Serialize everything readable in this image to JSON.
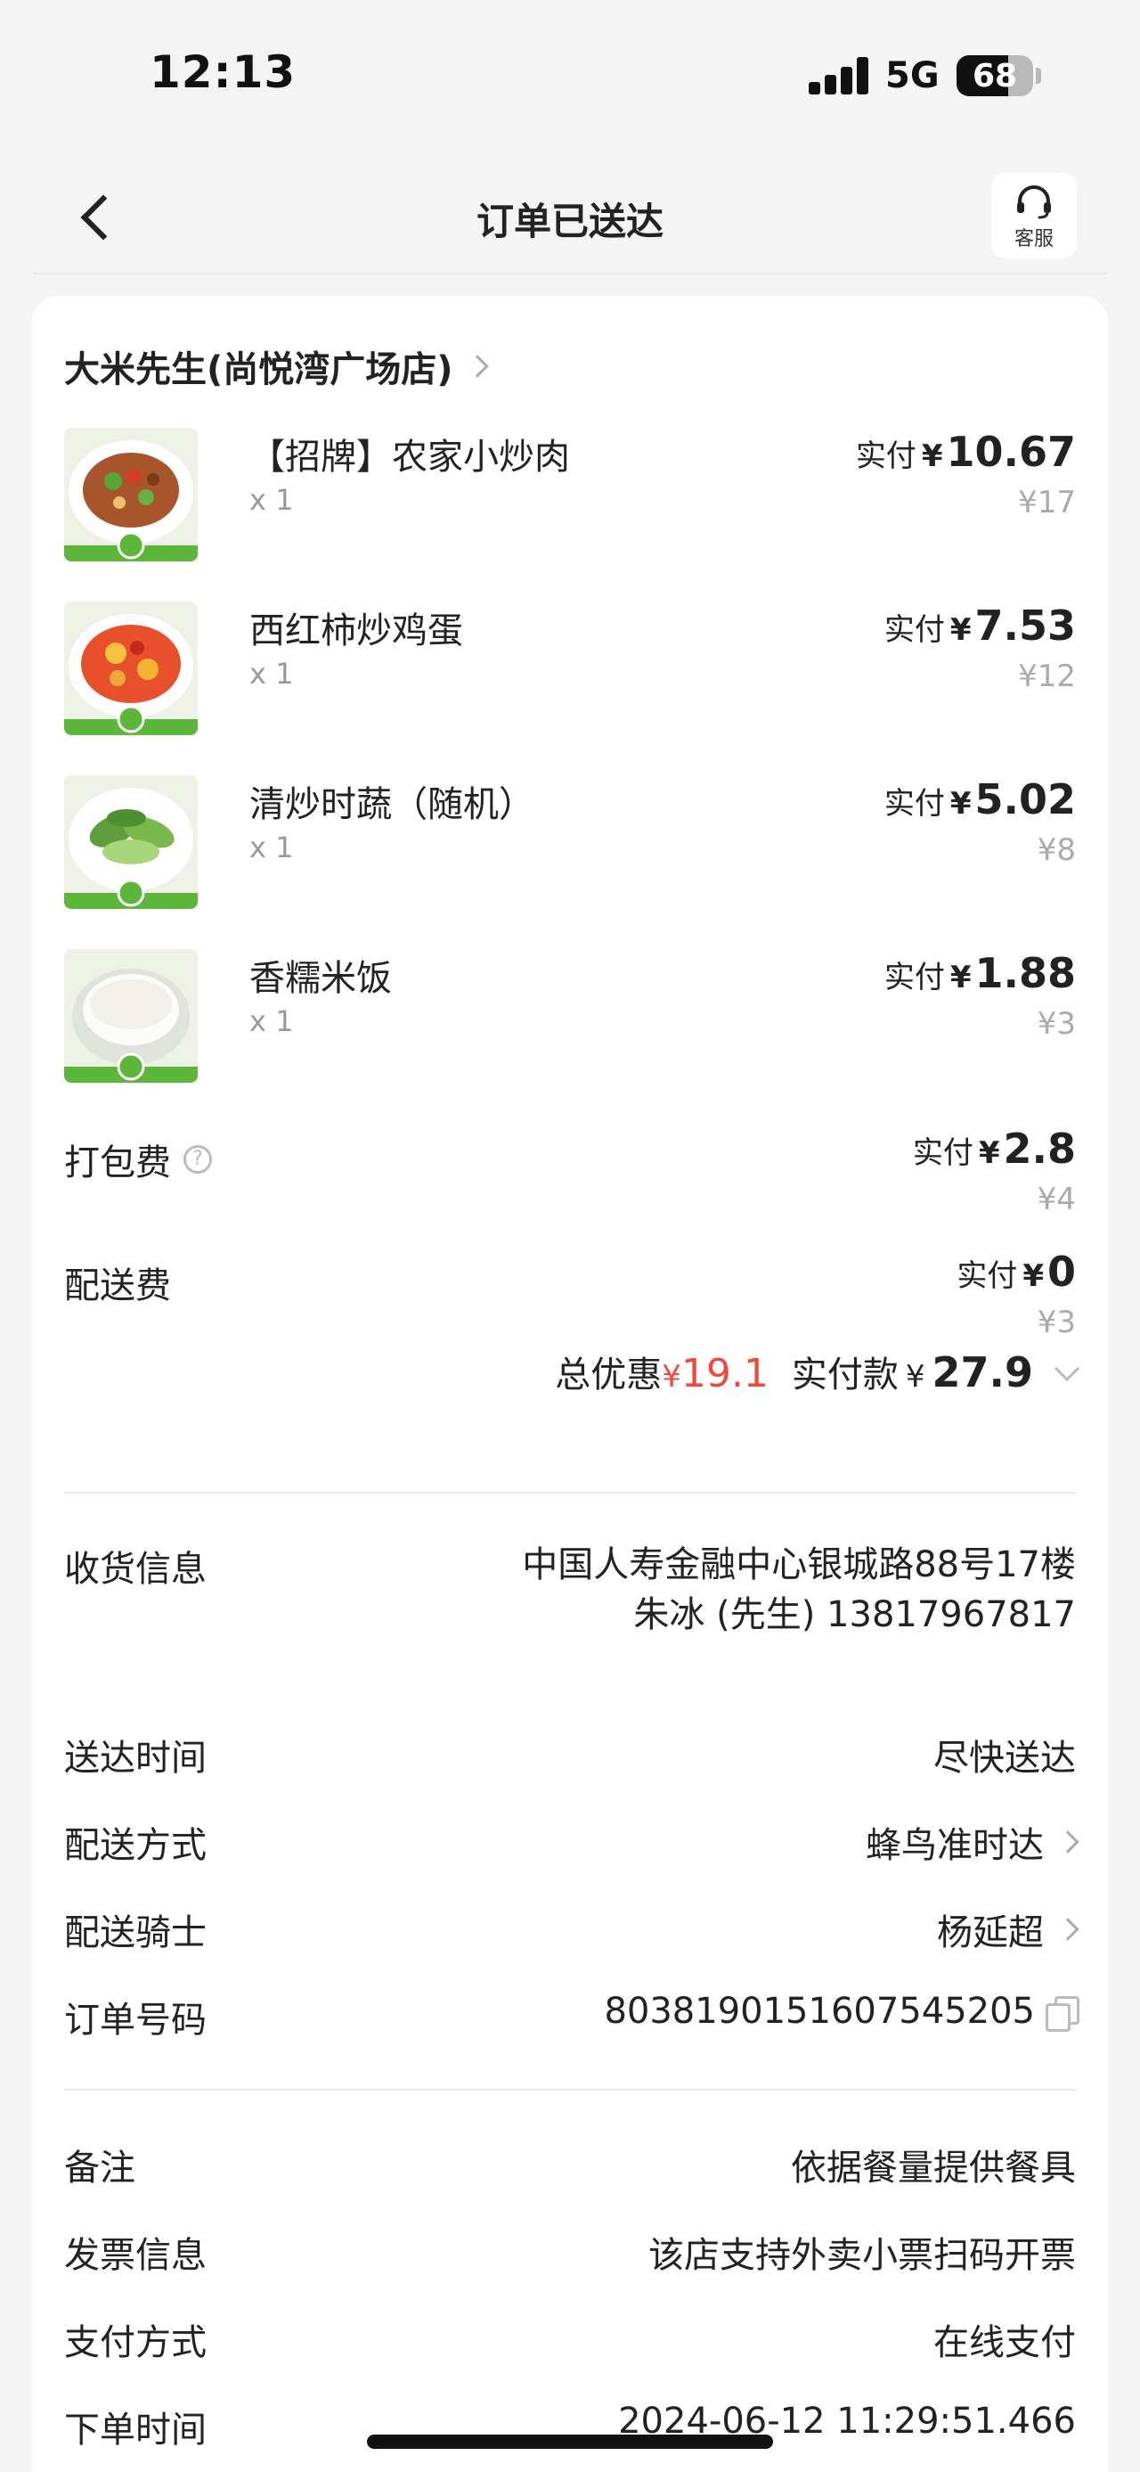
{
  "status_bar": {
    "time": "12:13",
    "network": "5G",
    "battery": "68",
    "battery_level": 0.68
  },
  "nav": {
    "title": "订单已送达",
    "service_label": "客服"
  },
  "store": {
    "name": "大米先生(尚悦湾广场店)"
  },
  "items": [
    {
      "name": "【招牌】农家小炒肉",
      "qty": "x 1",
      "paid_label": "实付",
      "currency": "¥",
      "paid": "10.67",
      "original": "¥17"
    },
    {
      "name": "西红柿炒鸡蛋",
      "qty": "x 1",
      "paid_label": "实付",
      "currency": "¥",
      "paid": "7.53",
      "original": "¥12"
    },
    {
      "name": "清炒时蔬（随机）",
      "qty": "x 1",
      "paid_label": "实付",
      "currency": "¥",
      "paid": "5.02",
      "original": "¥8"
    },
    {
      "name": "香糯米饭",
      "qty": "x 1",
      "paid_label": "实付",
      "currency": "¥",
      "paid": "1.88",
      "original": "¥3"
    }
  ],
  "fees": [
    {
      "label": "打包费",
      "paid_label": "实付",
      "currency": "¥",
      "paid": "2.8",
      "original": "¥4",
      "has_help": true
    },
    {
      "label": "配送费",
      "paid_label": "实付",
      "currency": "¥",
      "paid": "0",
      "original": "¥3",
      "has_help": false
    }
  ],
  "summary": {
    "discount_label": "总优惠",
    "currency": "¥",
    "discount": "19.1",
    "paid_label": "实付款",
    "paid": "27.9"
  },
  "delivery": {
    "address_label": "收货信息",
    "address": "中国人寿金融中心银城路88号17楼",
    "contact": "朱冰 (先生) 13817967817",
    "time_label": "送达时间",
    "time": "尽快送达",
    "method_label": "配送方式",
    "method": "蜂鸟准时达",
    "rider_label": "配送骑士",
    "rider": "杨延超",
    "order_label": "订单号码",
    "order_no": "8038190151607545205"
  },
  "extra": {
    "note_label": "备注",
    "note": "依据餐量提供餐具",
    "invoice_label": "发票信息",
    "invoice": "该店支持外卖小票扫码开票",
    "payment_label": "支付方式",
    "payment": "在线支付",
    "order_time_label": "下单时间",
    "order_time": "2024-06-12 11:29:51.466"
  },
  "colors": {
    "accent_red": "#f2483c",
    "background": "#f4f4f4",
    "card": "#ffffff"
  },
  "icons": [
    "back-arrow-icon",
    "headset-icon",
    "chevron-right-icon",
    "help-icon",
    "chevron-down-icon",
    "copy-icon"
  ]
}
